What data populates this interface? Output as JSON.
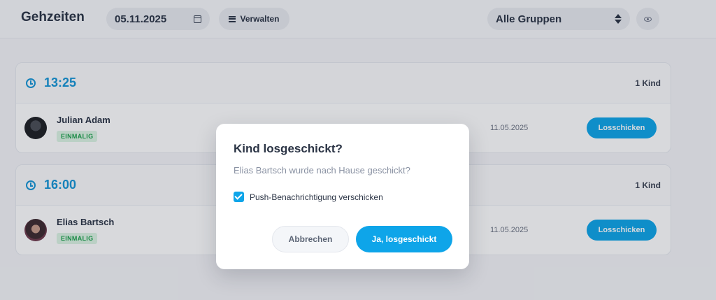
{
  "header": {
    "title": "Gehzeiten",
    "date": "05.11.2025",
    "manage_label": "Verwalten",
    "group_select": "Alle Gruppen"
  },
  "groups": [
    {
      "time": "13:25",
      "count": "1 Kind",
      "children": [
        {
          "name": "Julian Adam",
          "tag": "EINMALIG",
          "date": "11.05.2025",
          "action": "Losschicken"
        }
      ]
    },
    {
      "time": "16:00",
      "count": "1 Kind",
      "children": [
        {
          "name": "Elias Bartsch",
          "tag": "EINMALIG",
          "date": "11.05.2025",
          "action": "Losschicken"
        }
      ]
    }
  ],
  "modal": {
    "title": "Kind losgeschickt?",
    "message": "Elias Bartsch wurde nach Hause geschickt?",
    "checkbox_label": "Push-Benachrichtigung verschicken",
    "checkbox_checked": true,
    "cancel_label": "Abbrechen",
    "confirm_label": "Ja, losgeschickt"
  },
  "icons": {
    "calendar": "calendar-icon",
    "list": "list-icon",
    "select": "chevron-updown-icon",
    "visibility": "eye-icon",
    "clock": "clock-icon",
    "check": "check-icon"
  },
  "colors": {
    "accent": "#0ea5e9",
    "time_text": "#1596d6",
    "tag_green": "#1fa24d",
    "tag_bg": "#dcf5e4"
  }
}
